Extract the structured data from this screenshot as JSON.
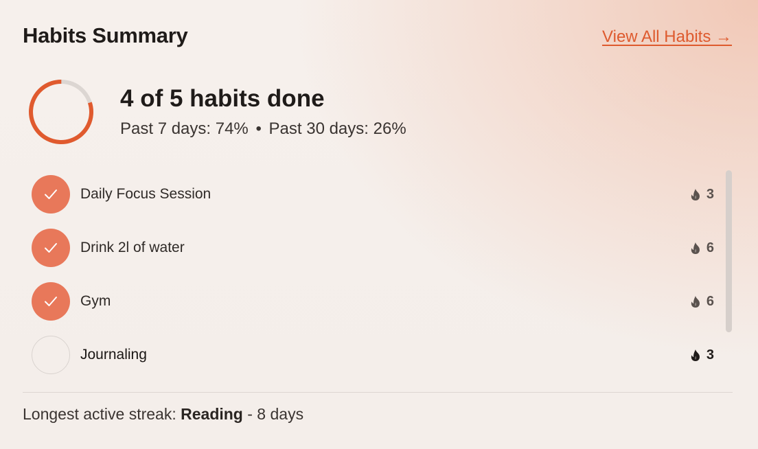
{
  "header": {
    "title": "Habits Summary",
    "view_all_label": "View All Habits →"
  },
  "summary": {
    "done_text": "4 of 5 habits done",
    "progress_fraction": 0.8,
    "past_7_label": "Past 7 days: 74%",
    "separator": "•",
    "past_30_label": "Past 30 days: 26%"
  },
  "habits": [
    {
      "name": "Daily Focus Session",
      "done": true,
      "streak": "3",
      "streak_icon": "flame-icon"
    },
    {
      "name": "Drink 2l of water",
      "done": true,
      "streak": "6",
      "streak_icon": "flame-icon"
    },
    {
      "name": "Gym",
      "done": true,
      "streak": "6",
      "streak_icon": "flame-icon"
    },
    {
      "name": "Journaling",
      "done": false,
      "streak": "3",
      "streak_icon": "flame-icon"
    }
  ],
  "footer": {
    "prefix": "Longest active streak: ",
    "habit": "Reading",
    "suffix": " - 8 days"
  },
  "colors": {
    "accent": "#e05a2e",
    "check_fill": "#e8785a",
    "ring_track": "#dcd6d2"
  }
}
